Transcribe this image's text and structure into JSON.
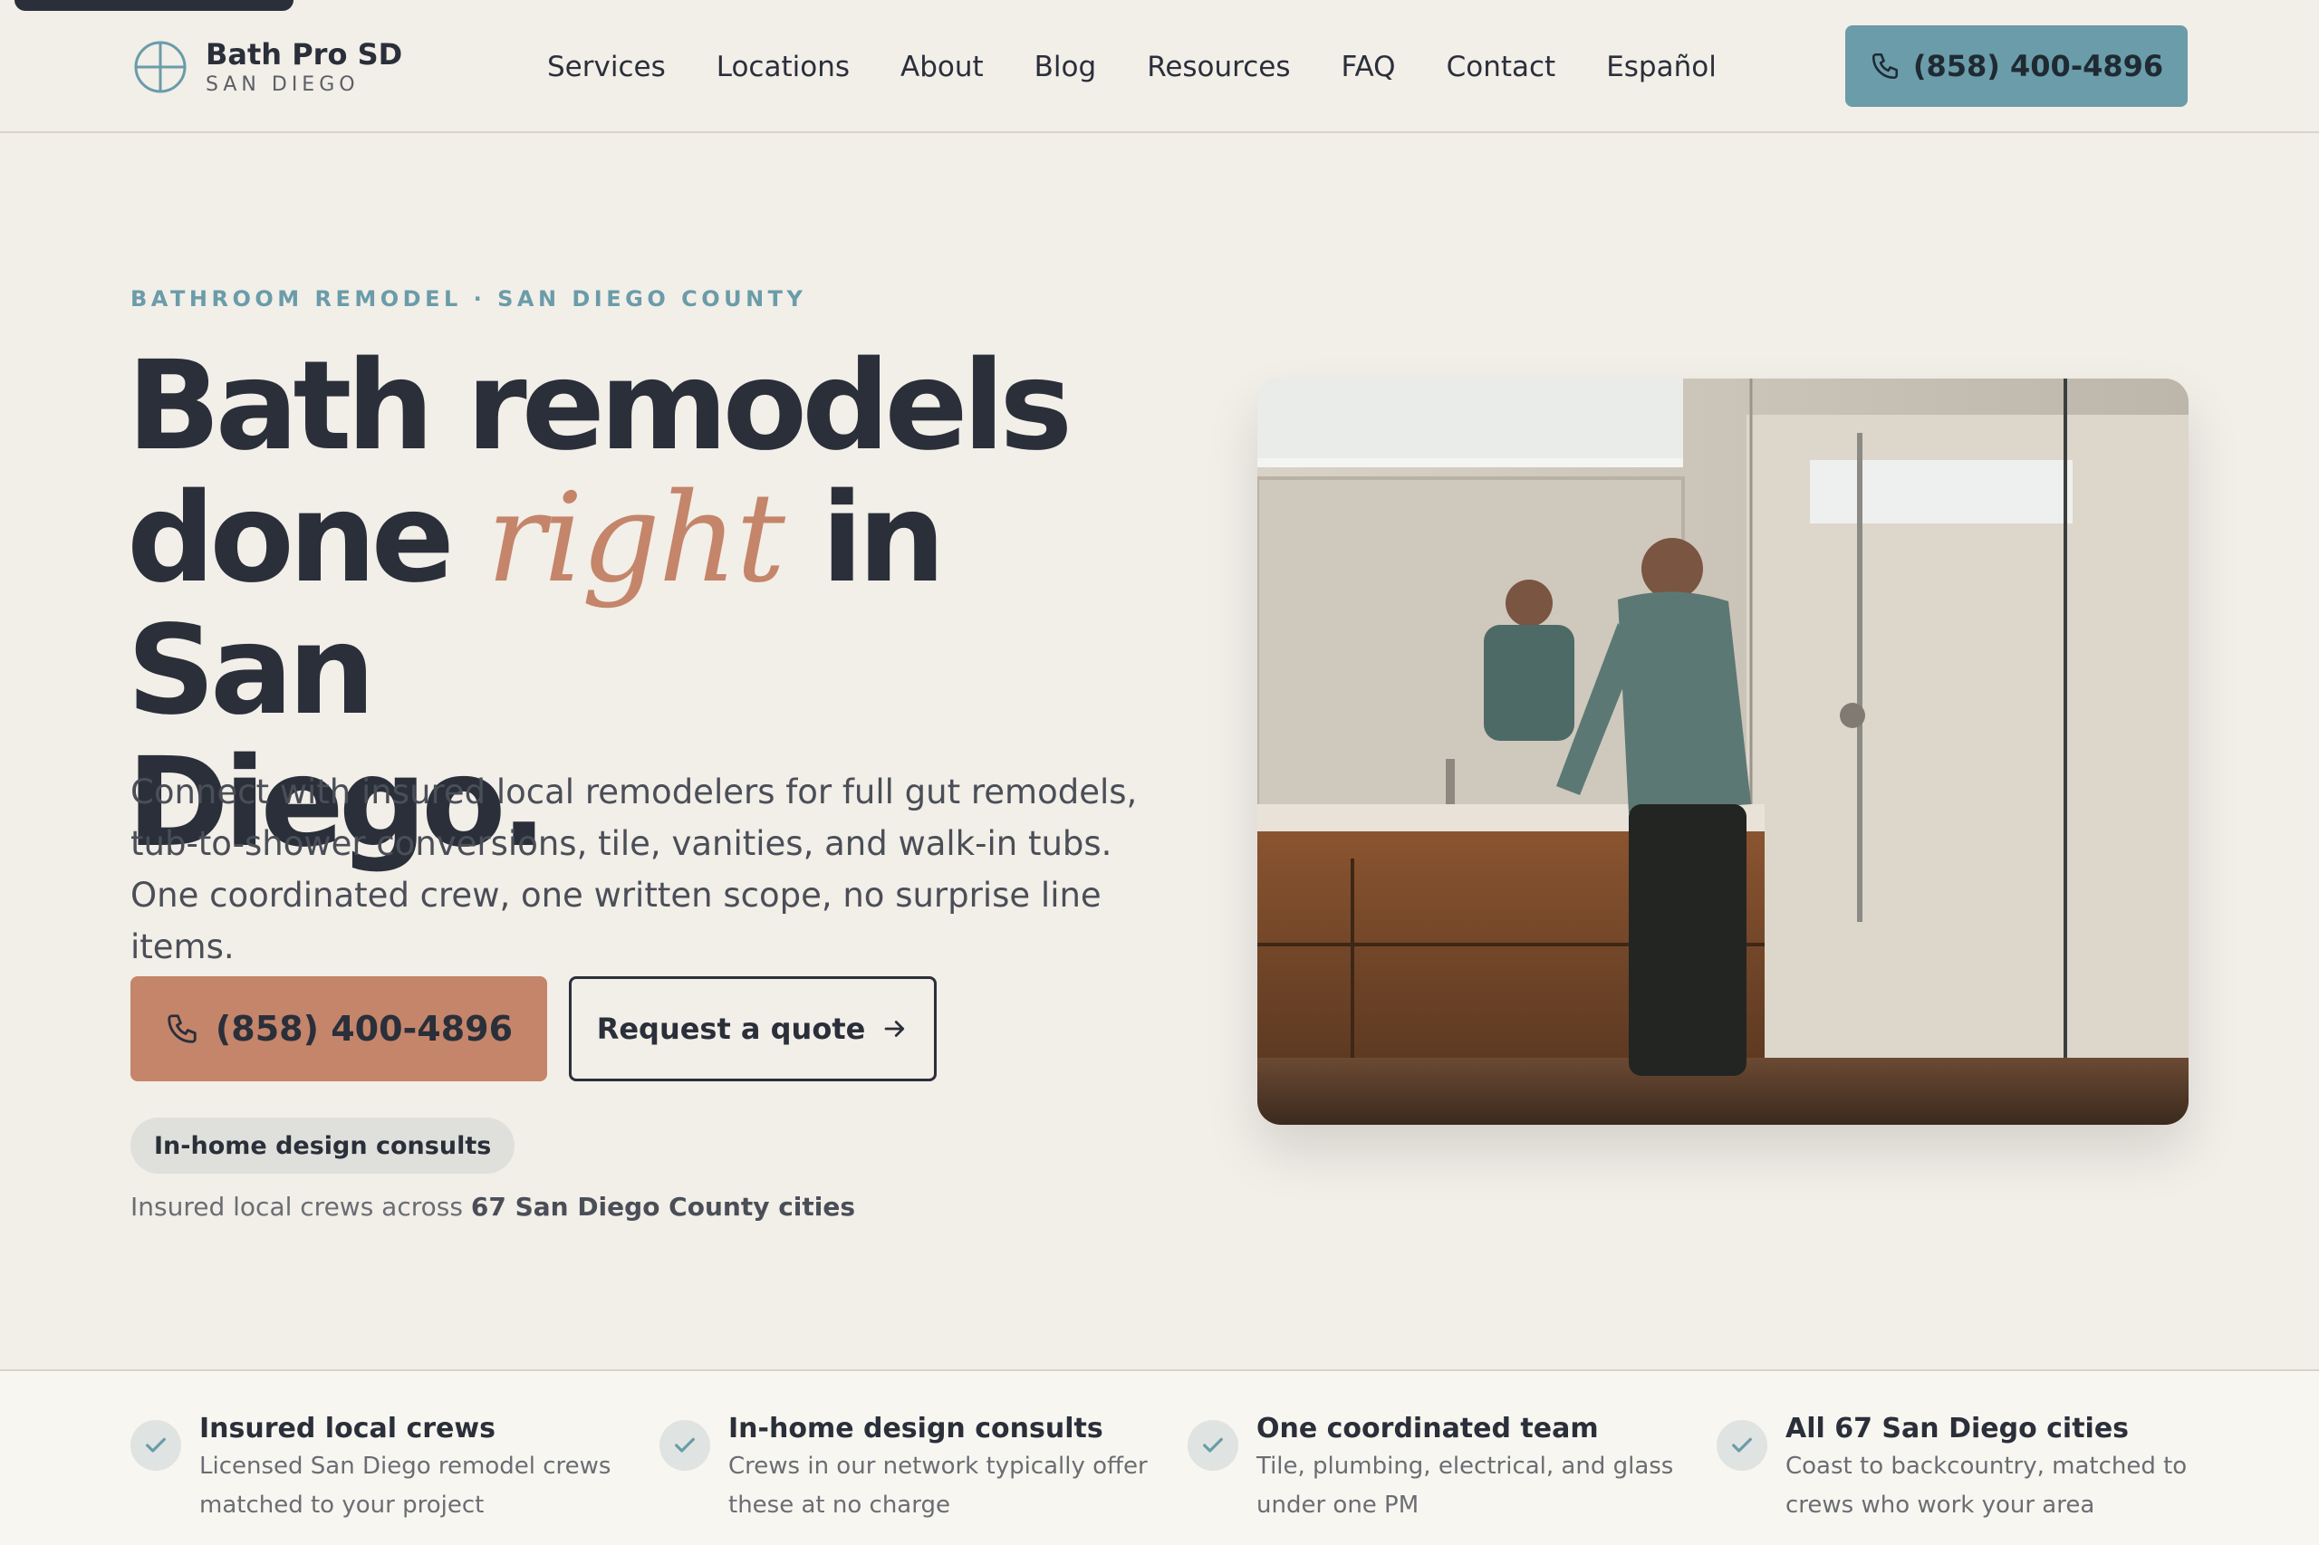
{
  "header": {
    "brand_name": "Bath Pro SD",
    "brand_sub": "SAN DIEGO",
    "nav": [
      "Services",
      "Locations",
      "About",
      "Blog",
      "Resources",
      "FAQ",
      "Contact",
      "Español"
    ],
    "phone": "(858) 400-4896"
  },
  "hero": {
    "eyebrow": "BATHROOM REMODEL · SAN DIEGO COUNTY",
    "title_1": "Bath remodels",
    "title_2": "done",
    "title_accent": "right",
    "title_3": "in San",
    "title_4": "Diego.",
    "description": "Connect with insured local remodelers for full gut remodels, tub-to-shower conversions, tile, vanities, and walk-in tubs. One coordinated crew, one written scope, no surprise line items.",
    "call_label": "(858) 400-4896",
    "quote_label": "Request a quote",
    "chip": "In-home design consults",
    "coverage_prefix": "Insured local crews across",
    "coverage_strong": "67 San Diego County cities"
  },
  "trust": [
    {
      "title": "Insured local crews",
      "desc": "Licensed San Diego remodel crews matched to your project"
    },
    {
      "title": "In-home design consults",
      "desc": "Crews in our network typically offer these at no charge"
    },
    {
      "title": "One coordinated team",
      "desc": "Tile, plumbing, electrical, and glass under one PM"
    },
    {
      "title": "All 67 San Diego cities",
      "desc": "Coast to backcountry, matched to crews who work your area"
    }
  ],
  "colors": {
    "background": "#f2eee8",
    "accent_teal": "#6a9ca9",
    "accent_terracotta": "#c4856a",
    "ink": "#2a2f3a"
  },
  "icons": [
    "plus-circle-logo-icon",
    "phone-icon",
    "arrow-right-icon",
    "check-icon"
  ]
}
